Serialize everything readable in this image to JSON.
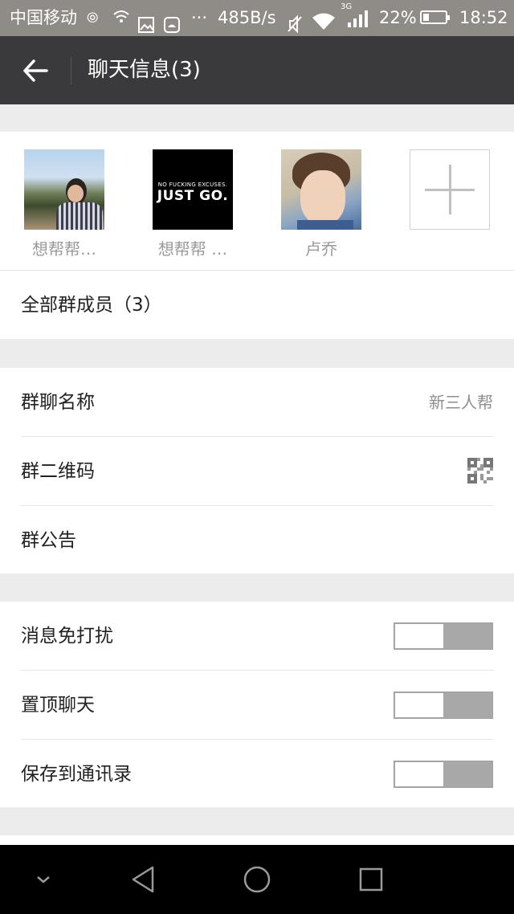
{
  "status_bar": {
    "carrier": "中国移动",
    "network_speed": "485B/s",
    "network_type": "3G",
    "battery_percent": "22%",
    "battery_level": 0.22,
    "time": "18:52",
    "icons": [
      "message-icon",
      "wifi-small-icon",
      "image-icon",
      "android-icon",
      "more-dots-icon",
      "mute-icon",
      "wifi-icon",
      "signal-icon",
      "battery-icon"
    ]
  },
  "header": {
    "title": "聊天信息(3)",
    "back_icon": "arrow-left-icon",
    "background": "#3a3a3d"
  },
  "members": [
    {
      "name": "想帮帮…",
      "avatar": "woman-sunglasses-photo"
    },
    {
      "name": "想帮帮 …",
      "avatar": "just-go-image",
      "avatar_text_small": "NO FUCKING EXCUSES.",
      "avatar_text_big": "JUST GO."
    },
    {
      "name": "卢乔",
      "avatar": "boy-photo"
    }
  ],
  "add_member_icon": "plus-icon",
  "all_members_label": "全部群成员（3）",
  "group_info": {
    "name_label": "群聊名称",
    "name_value": "新三人帮",
    "qr_label": "群二维码",
    "qr_icon": "qr-code-icon",
    "notice_label": "群公告"
  },
  "settings": [
    {
      "label": "消息免打扰",
      "on": false
    },
    {
      "label": "置顶聊天",
      "on": false
    },
    {
      "label": "保存到通讯录",
      "on": false
    }
  ],
  "nav_bar": {
    "icons": [
      "chevron-down-icon",
      "back-triangle-icon",
      "home-circle-icon",
      "recents-square-icon"
    ]
  }
}
